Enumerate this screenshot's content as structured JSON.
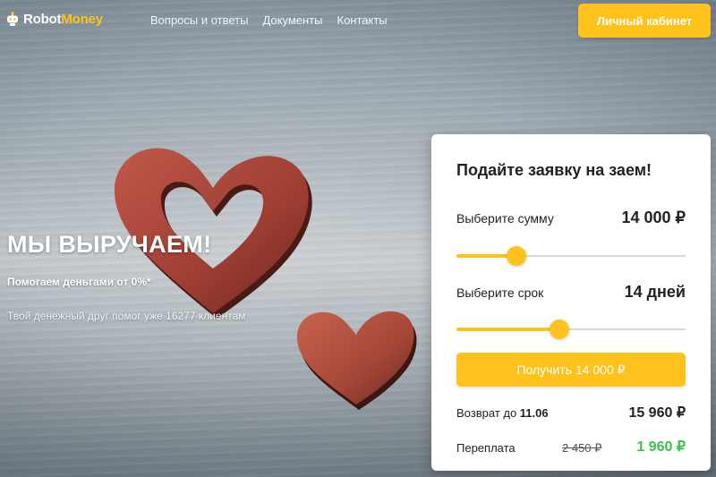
{
  "header": {
    "logo_robot": "Robot",
    "logo_money": "Money",
    "nav": [
      "Вопросы и ответы",
      "Документы",
      "Контакты"
    ],
    "cabinet_label": "Личный кабинет"
  },
  "hero": {
    "title": "МЫ ВЫРУЧАЕМ!",
    "subtitle": "Помогаем деньгами от 0%*",
    "description": "Твой денежный друг помог уже 16277 клиентам"
  },
  "loan_form": {
    "title": "Подайте заявку на заем!",
    "amount_label": "Выберите сумму",
    "amount_value": "14 000 ₽",
    "amount_slider_fraction": 0.26,
    "term_label": "Выберите срок",
    "term_value": "14 дней",
    "term_slider_fraction": 0.45,
    "submit_label": "Получить  14 000 ₽",
    "return_label": "Возврат до ",
    "return_date": "11.06",
    "return_value": "15 960 ₽",
    "overpay_label": "Переплата",
    "overpay_old": "2 450 ₽",
    "overpay_new": "1 960 ₽"
  },
  "colors": {
    "accent": "#ffc21c",
    "logo_money": "#ffc516",
    "overpay_green": "#3cc24a",
    "heart": "#b04a3c"
  },
  "icons": [
    "robot-logo-icon"
  ]
}
